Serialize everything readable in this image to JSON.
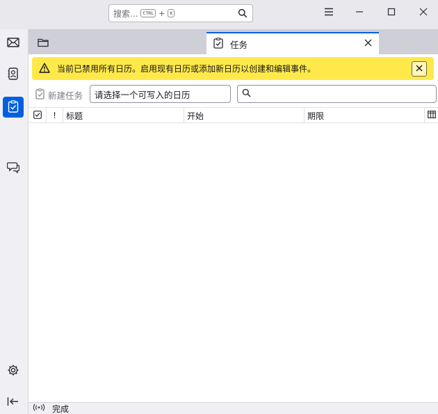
{
  "titlebar": {
    "search_placeholder": "搜索...",
    "shortcut_ctrl": "CTRL",
    "shortcut_plus": "+",
    "shortcut_key": "K"
  },
  "spaces": {
    "icons": [
      "mail-icon",
      "address-book-icon",
      "calendar-icon",
      "tasks-icon",
      "chat-icon",
      "settings-icon",
      "collapse-icon"
    ],
    "active": "tasks"
  },
  "tabs": [
    {
      "label": "",
      "icon": "folder-icon"
    },
    {
      "label": "任务",
      "icon": "tasks-icon",
      "active": true
    }
  ],
  "notification": {
    "text": "当前已禁用所有日历。启用现有日历或添加新日历以创建和编辑事件。"
  },
  "toolbar": {
    "new_task_label": "新建任务",
    "calendar_select_value": "请选择一个可写入的日历",
    "filter_value": ""
  },
  "columns": {
    "priority": "!",
    "title": "标题",
    "start": "开始",
    "due": "期限"
  },
  "status": {
    "text": "完成"
  },
  "colors": {
    "accent": "#0060df",
    "notification_bg": "#ffe94a"
  }
}
